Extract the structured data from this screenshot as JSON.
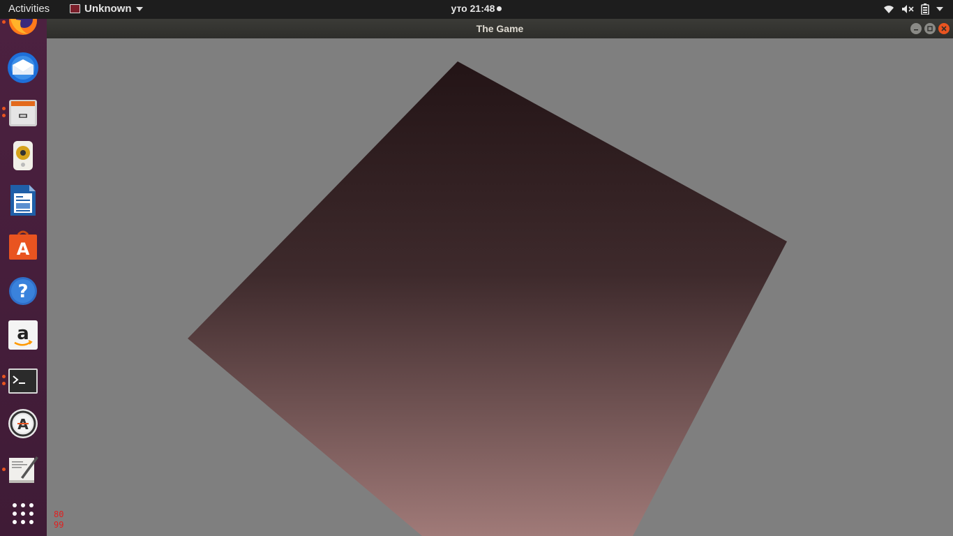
{
  "topbar": {
    "activities_label": "Activities",
    "app_menu_label": "Unknown",
    "clock_text": "уто 21:48"
  },
  "dock": {
    "items": [
      {
        "name": "Firefox",
        "icon": "firefox-icon",
        "running": true
      },
      {
        "name": "Thunderbird Mail",
        "icon": "thunderbird-icon",
        "running": false
      },
      {
        "name": "Files",
        "icon": "files-icon",
        "running": true
      },
      {
        "name": "Rhythmbox",
        "icon": "rhythmbox-icon",
        "running": false
      },
      {
        "name": "LibreOffice Writer",
        "icon": "libreoffice-writer-icon",
        "running": false
      },
      {
        "name": "Ubuntu Software",
        "icon": "ubuntu-software-icon",
        "running": false
      },
      {
        "name": "Help",
        "icon": "help-icon",
        "running": false
      },
      {
        "name": "Amazon",
        "icon": "amazon-icon",
        "running": false
      },
      {
        "name": "Terminal",
        "icon": "terminal-icon",
        "running": true
      },
      {
        "name": "Software Updater",
        "icon": "software-updater-icon",
        "running": false
      },
      {
        "name": "Text Editor",
        "icon": "text-editor-icon",
        "running": true
      },
      {
        "name": "Show Applications",
        "icon": "app-grid-icon",
        "running": false
      }
    ]
  },
  "window": {
    "title": "The Game"
  },
  "game": {
    "overlay_line1": "80",
    "overlay_line2": "99",
    "background_color": "#7f7f7f",
    "quad_top_color": "#231416",
    "quad_bottom_color": "#a07a78"
  },
  "colors": {
    "accent": "#e95420",
    "dock_bg": "#4a1f3e",
    "topbar_bg": "#1d1d1d"
  }
}
